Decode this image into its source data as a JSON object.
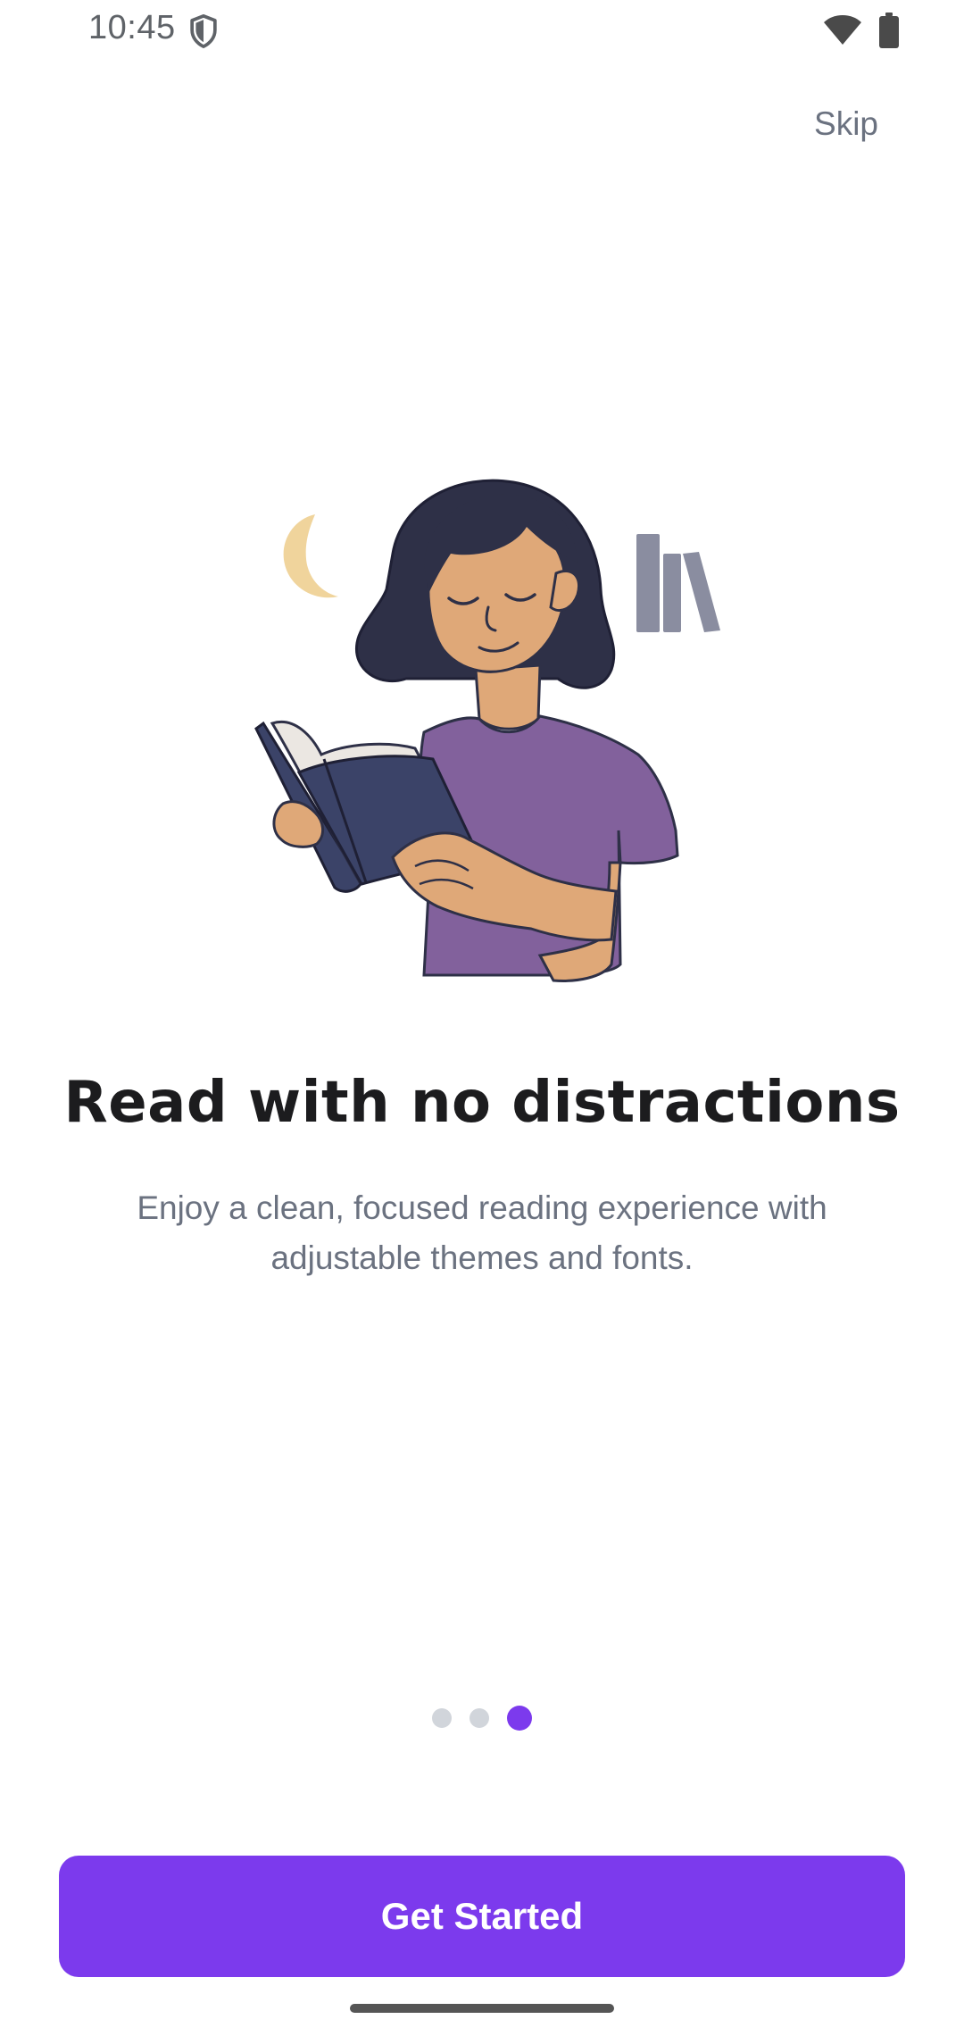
{
  "status_bar": {
    "time": "10:45",
    "icons": [
      "shield-icon",
      "wifi-icon",
      "battery-icon"
    ]
  },
  "header": {
    "skip_label": "Skip"
  },
  "illustration": {
    "subject": "woman-reading-book-icon",
    "decorations": [
      "moon-icon",
      "books-icon"
    ]
  },
  "content": {
    "title": "Read with no distractions",
    "subtitle": "Enjoy a clean, focused reading experience with adjustable themes and fonts."
  },
  "pager": {
    "total": 3,
    "current": 3
  },
  "cta": {
    "label": "Get Started"
  },
  "colors": {
    "accent": "#7c3aed",
    "dot_inactive": "#d1d5db",
    "title": "#1c1c1e",
    "subtitle": "#6b7280"
  }
}
